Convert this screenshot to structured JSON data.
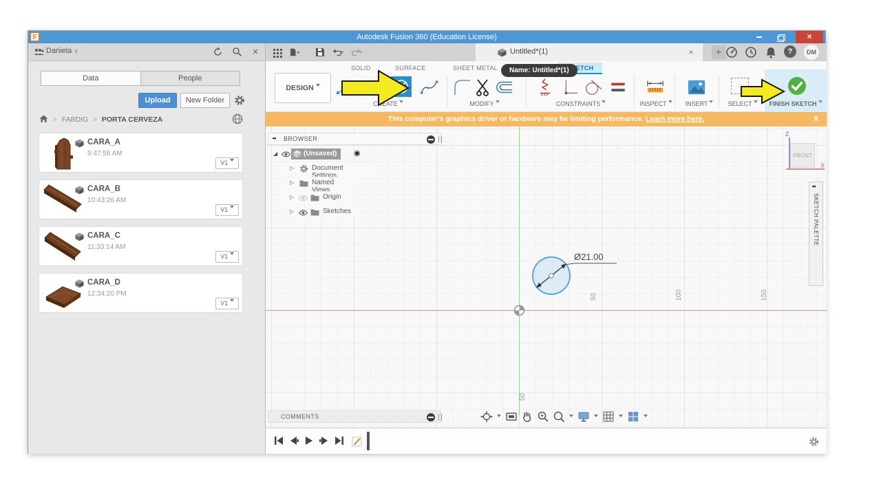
{
  "window": {
    "logo": "F",
    "title": "Autodesk Fusion 360 (Education License)"
  },
  "icons": {
    "caret_down": "▾",
    "chevron_down": "∨",
    "breadcrumb_sep": ">",
    "collapse_left": "◂◂",
    "tree_collapsed": "▷",
    "tree_expanded": "◢",
    "target": "◉",
    "help": "?",
    "close": "×",
    "banner_close": "X",
    "plus": "+"
  },
  "left_panel": {
    "user": "Daniela",
    "tab_data": "Data",
    "tab_people": "People",
    "upload": "Upload",
    "new_folder": "New Folder",
    "breadcrumb_root": "FABDIG",
    "breadcrumb_current": "PORTA CERVEZA",
    "items": [
      {
        "name": "CARA_A",
        "time": "9:47:58 AM",
        "version": "V1"
      },
      {
        "name": "CARA_B",
        "time": "10:43:26 AM",
        "version": "V1"
      },
      {
        "name": "CARA_C",
        "time": "11:33:14 AM",
        "version": "V1"
      },
      {
        "name": "CARA_D",
        "time": "12:34:20 PM",
        "version": "V1"
      }
    ]
  },
  "doc_bar": {
    "tab_title": "Untitled*(1)",
    "avatar": "DM"
  },
  "ribbon": {
    "design": "DESIGN",
    "tab_solid": "SOLID",
    "tab_surface": "SURFACE",
    "tab_sheet_metal": "SHEET METAL",
    "tab_sketch": "SKETCH",
    "tooltip": "Name: Untitled*(1)",
    "create": "CREATE",
    "modify": "MODIFY",
    "constraints": "CONSTRAINTS",
    "inspect": "INSPECT",
    "insert": "INSERT",
    "select": "SELECT",
    "finish_sketch": "FINISH SKETCH"
  },
  "banner": {
    "message": "This computer's graphics driver or hardware may be limiting performance.",
    "link": "Learn more here."
  },
  "browser": {
    "title": "BROWSER",
    "root": "(Unsaved)",
    "nodes": [
      {
        "label": "Document Settings"
      },
      {
        "label": "Named Views"
      },
      {
        "label": "Origin"
      },
      {
        "label": "Sketches"
      }
    ]
  },
  "canvas": {
    "dimension": "Ø21.00",
    "x_labels": [
      "50",
      "100",
      "150"
    ],
    "y_label": "50",
    "viewcube_face": "FRONT",
    "viewcube_z": "Z",
    "viewcube_x": "X",
    "sketch_palette": "SKETCH PALETTE"
  },
  "comments": {
    "label": "COMMENTS"
  }
}
